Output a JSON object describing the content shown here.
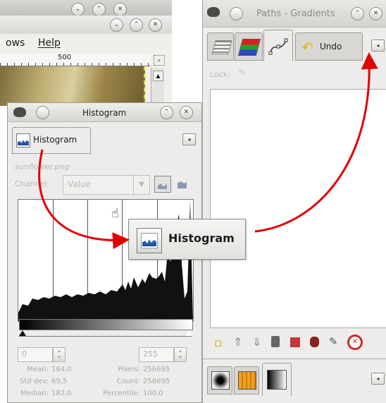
{
  "image_window": {
    "menu": [
      "ows",
      "Help"
    ],
    "ruler_mark": "500"
  },
  "paths_window": {
    "title": "Paths - Gradients",
    "undo_label": "Undo",
    "lock_label": "Lock:"
  },
  "histogram_window": {
    "title": "Histogram",
    "tab_label": "Histogram",
    "image_name": "sunflower.png",
    "channel_label": "Channel:",
    "channel_value": "Value",
    "range_min": "0",
    "range_max": "255",
    "stats": {
      "mean_label": "Mean:",
      "mean_value": "164,0",
      "stddev_label": "Std dev:",
      "stddev_value": "69,5",
      "median_label": "Median:",
      "median_value": "182,0",
      "pixels_label": "Pixels:",
      "pixels_value": "256695",
      "count_label": "Count:",
      "count_value": "256695",
      "percentile_label": "Percentile:",
      "percentile_value": "100,0"
    }
  },
  "drag_tooltip": {
    "label": "Histogram"
  },
  "colors": {
    "arrow": "#e00000",
    "window_bg": "#edeceb",
    "histogram_fill": "#111111"
  },
  "icons": [
    "gimp-wilber-icon",
    "layers-icon",
    "channels-icon",
    "paths-icon",
    "undo-icon",
    "histogram-icon",
    "hand-cursor-icon"
  ]
}
